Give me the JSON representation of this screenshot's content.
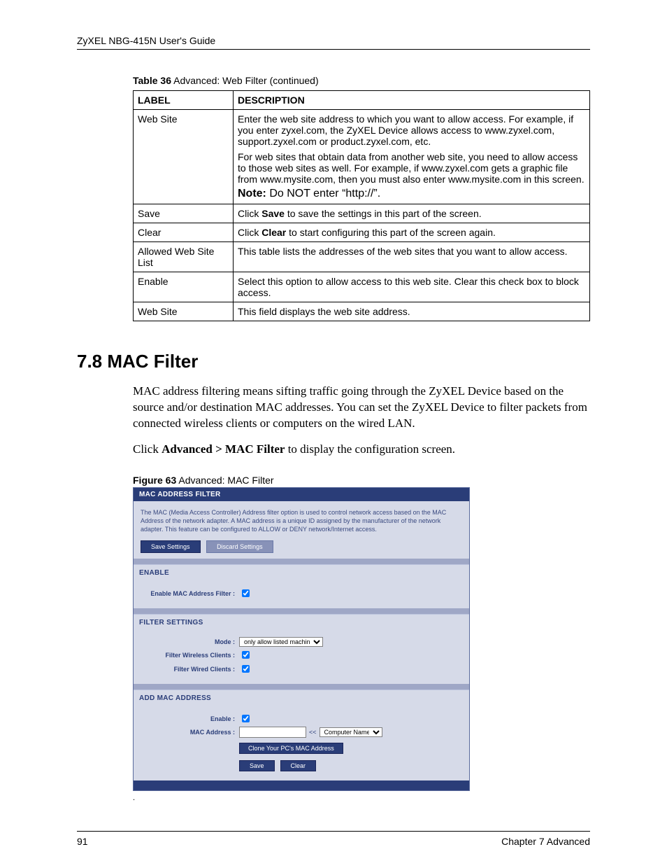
{
  "header": "ZyXEL NBG-415N User's Guide",
  "table_caption_bold": "Table 36",
  "table_caption_rest": "   Advanced: Web Filter (continued)",
  "th": {
    "label": "LABEL",
    "desc": "DESCRIPTION"
  },
  "rows": {
    "r1_label": "Web Site",
    "r1_p1": "Enter the web site address to which you want to allow access. For example, if you enter zyxel.com, the ZyXEL Device allows access to www.zyxel.com, support.zyxel.com or product.zyxel.com, etc.",
    "r1_p2": "For web sites that obtain data from another web site, you need to allow access to those web sites as well. For example, if www.zyxel.com gets a graphic file from www.mysite.com, then you must also enter www.mysite.com in this screen.",
    "r1_note_b": "Note:",
    "r1_note": " Do NOT enter “http://”.",
    "r2_label": "Save",
    "r2_pre": "Click ",
    "r2_bold": "Save",
    "r2_post": " to save the settings in this part of the screen.",
    "r3_label": "Clear",
    "r3_pre": "Click ",
    "r3_bold": "Clear",
    "r3_post": " to start configuring this part of the screen again.",
    "r4_label": "Allowed Web Site List",
    "r4_desc": "This table lists the addresses of the web sites that you want to allow access.",
    "r5_label": "Enable",
    "r5_desc": "Select this option to allow access to this web site. Clear this check box to block access.",
    "r6_label": "Web Site",
    "r6_desc": "This field displays the web site address."
  },
  "section_heading": "7.8  MAC Filter",
  "para1": "MAC address filtering means sifting traffic going through the ZyXEL Device based on the source and/or destination MAC addresses. You can set the ZyXEL Device to filter packets from connected wireless clients or computers on the wired LAN.",
  "para2_pre": "Click ",
  "para2_bold": "Advanced > MAC Filter",
  "para2_post": " to display the configuration screen.",
  "fig_caption_bold": "Figure 63",
  "fig_caption_rest": "   Advanced: MAC Filter",
  "fig": {
    "title": "MAC ADDRESS FILTER",
    "help": "The MAC (Media Access Controller) Address filter option is used to control network access based on the MAC Address of the network adapter. A MAC address is a unique ID assigned by the manufacturer of the network adapter. This feature can be configured to ALLOW or DENY network/Internet access.",
    "save": "Save Settings",
    "discard": "Discard Settings",
    "enable_head": "ENABLE",
    "enable_label": "Enable MAC Address Filter :",
    "filter_head": "FILTER SETTINGS",
    "mode_label": "Mode :",
    "mode_value": "only allow listed machines",
    "fw_label": "Filter Wireless Clients :",
    "fwired_label": "Filter Wired Clients :",
    "add_head": "ADD MAC ADDRESS",
    "add_enable_label": "Enable :",
    "mac_label": "MAC Address :",
    "arrows": "<<",
    "comp_name": "Computer Name",
    "clone": "Clone Your PC's MAC Address",
    "save2": "Save",
    "clear2": "Clear"
  },
  "footer_left": "91",
  "footer_right": "Chapter 7 Advanced"
}
